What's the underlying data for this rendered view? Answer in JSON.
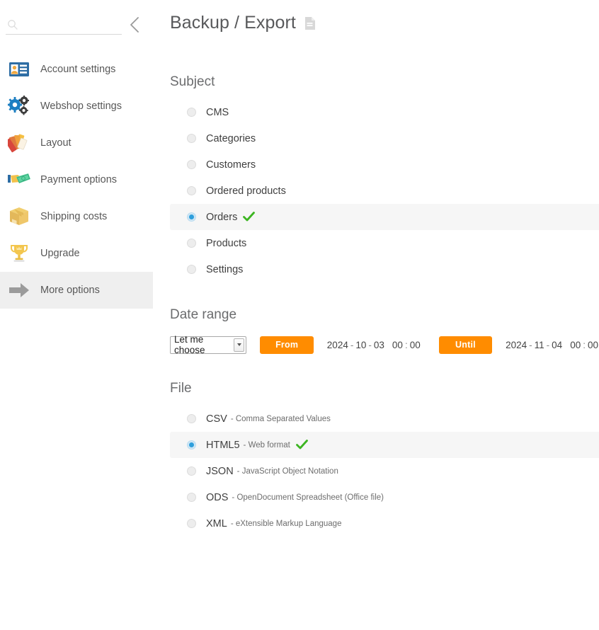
{
  "sidebar": {
    "search": {
      "placeholder": "",
      "value": "",
      "icon": "search-icon"
    },
    "collapse_icon": "chevron-left-icon",
    "items": [
      {
        "label": "Account settings",
        "icon": "id-card-icon",
        "active": false
      },
      {
        "label": "Webshop settings",
        "icon": "gears-icon",
        "active": false
      },
      {
        "label": "Layout",
        "icon": "color-swatch-icon",
        "active": false
      },
      {
        "label": "Payment options",
        "icon": "money-hand-icon",
        "active": false
      },
      {
        "label": "Shipping costs",
        "icon": "box-icon",
        "active": false
      },
      {
        "label": "Upgrade",
        "icon": "trophy-icon",
        "active": false
      },
      {
        "label": "More options",
        "icon": "arrow-right-icon",
        "active": true
      }
    ]
  },
  "header": {
    "title": "Backup / Export",
    "title_icon": "document-icon"
  },
  "subject": {
    "title": "Subject",
    "options": [
      {
        "label": "CMS",
        "selected": false
      },
      {
        "label": "Categories",
        "selected": false
      },
      {
        "label": "Customers",
        "selected": false
      },
      {
        "label": "Ordered products",
        "selected": false
      },
      {
        "label": "Orders",
        "selected": true
      },
      {
        "label": "Products",
        "selected": false
      },
      {
        "label": "Settings",
        "selected": false
      }
    ]
  },
  "date_range": {
    "title": "Date range",
    "preset_selected": "Let me choose",
    "from_label": "From",
    "until_label": "Until",
    "from": {
      "year": "2024",
      "month": "10",
      "day": "03",
      "hour": "00",
      "minute": "00"
    },
    "until": {
      "year": "2024",
      "month": "11",
      "day": "04",
      "hour": "00",
      "minute": "00"
    }
  },
  "file": {
    "title": "File",
    "options": [
      {
        "label": "CSV",
        "desc": "- Comma Separated Values",
        "selected": false
      },
      {
        "label": "HTML5",
        "desc": "- Web format",
        "selected": true
      },
      {
        "label": "JSON",
        "desc": "- JavaScript Object Notation",
        "selected": false
      },
      {
        "label": "ODS",
        "desc": "- OpenDocument Spreadsheet (Office file)",
        "selected": false
      },
      {
        "label": "XML",
        "desc": "- eXtensible Markup Language",
        "selected": false
      }
    ]
  },
  "colors": {
    "accent_orange": "#FF8C00",
    "radio_blue": "#2E9FDC",
    "check_green": "#3CB521",
    "row_highlight": "#F6F6F6",
    "sidebar_active": "#EFEFEF"
  }
}
